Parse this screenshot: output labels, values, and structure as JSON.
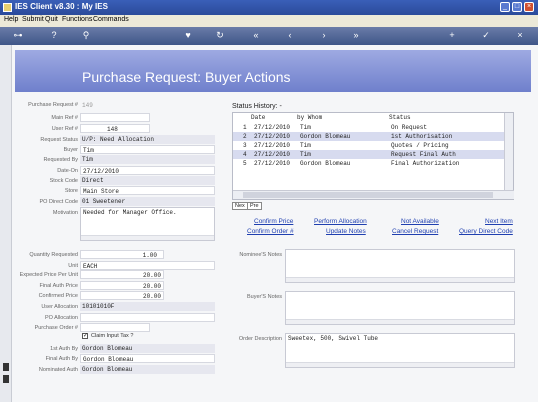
{
  "window": {
    "title": "IES Client v8.30 : My IES"
  },
  "menu": [
    "Help",
    "Submit",
    "Quit",
    "Functions",
    "Commands"
  ],
  "page_title": "Purchase Request: Buyer Actions",
  "form": {
    "purchase_request_label": "Purchase Request #",
    "purchase_request_value": "149",
    "main_ref_label": "Main Ref #",
    "main_ref_value": "",
    "user_ref_label": "User Ref #",
    "user_ref_value": "148",
    "request_status_label": "Request Status",
    "request_status_value": "U/P: Need Allocation",
    "buyer_label": "Buyer",
    "buyer_value": "Tim",
    "requested_by_label": "Requested By",
    "requested_by_value": "Tim",
    "date_on_label": "Date-On",
    "date_on_value": "27/12/2010",
    "stock_code_label": "Stock Code",
    "stock_code_value": "Direct",
    "store_label": "Store",
    "store_value": "Main Store",
    "po_direct_code_label": "PO Direct Code",
    "po_direct_code_value": "01 Sweetener",
    "motivation_label": "Motivation",
    "motivation_value": "Needed for Manager Office.",
    "qty_label": "Quantity Requested",
    "qty_value": "1.00",
    "unit_label": "Unit",
    "unit_value": "EACH",
    "exp_price_label": "Expected Price Per Unit",
    "exp_price_value": "20.00",
    "final_auth_price_label": "Final Auth Price",
    "final_auth_price_value": "20.00",
    "confirmed_price_label": "Confirmed Price",
    "confirmed_price_value": "20.00",
    "user_allocation_label": "User Allocation",
    "user_allocation_value": "10101010F",
    "po_allocation_label": "PO Allocation",
    "po_allocation_value": "",
    "purchase_order_label": "Purchase Order #",
    "purchase_order_value": "",
    "claim_input_tax_label": "Claim Input Tax ?",
    "first_auth_by_label": "1st Auth By",
    "first_auth_by_value": "Gordon Blomeau",
    "final_auth_by_label": "Final Auth By",
    "final_auth_by_value": "Gordon Blomeau",
    "nominated_auth_label": "Nominated Auth",
    "nominated_auth_value": "Gordon Blomeau"
  },
  "status_history": {
    "title": "Status History: -",
    "columns": [
      "Date",
      "by Whom",
      "Status"
    ],
    "rows": [
      {
        "n": "1",
        "date": "27/12/2010",
        "who": "Tim",
        "status": "On Request"
      },
      {
        "n": "2",
        "date": "27/12/2010",
        "who": "Gordon Blomeau",
        "status": "1st Authorisation"
      },
      {
        "n": "3",
        "date": "27/12/2010",
        "who": "Tim",
        "status": "Quotes / Pricing"
      },
      {
        "n": "4",
        "date": "27/12/2010",
        "who": "Tim",
        "status": "Request Final Auth"
      },
      {
        "n": "5",
        "date": "27/12/2010",
        "who": "Gordon Blomeau",
        "status": "Final Authorization"
      }
    ],
    "nav_next": "Nex",
    "nav_prev": "Pre"
  },
  "actions": {
    "confirm_price": "Confirm Price",
    "perform_allocation": "Perform Allocation",
    "not_available": "Not Available",
    "next_item": "Next Item",
    "confirm_order": "Confirm Order #",
    "update_notes": "Update Notes",
    "cancel_request": "Cancel Request",
    "query_direct_code": "Query Direct Code"
  },
  "notes": {
    "nominee_label": "Nominee'S Notes",
    "nominee_value": "",
    "buyer_label": "Buyer'S Notes",
    "buyer_value": "",
    "order_desc_label": "Order Description",
    "order_desc_value": "Sweetex, 500, Swivel Tube"
  }
}
